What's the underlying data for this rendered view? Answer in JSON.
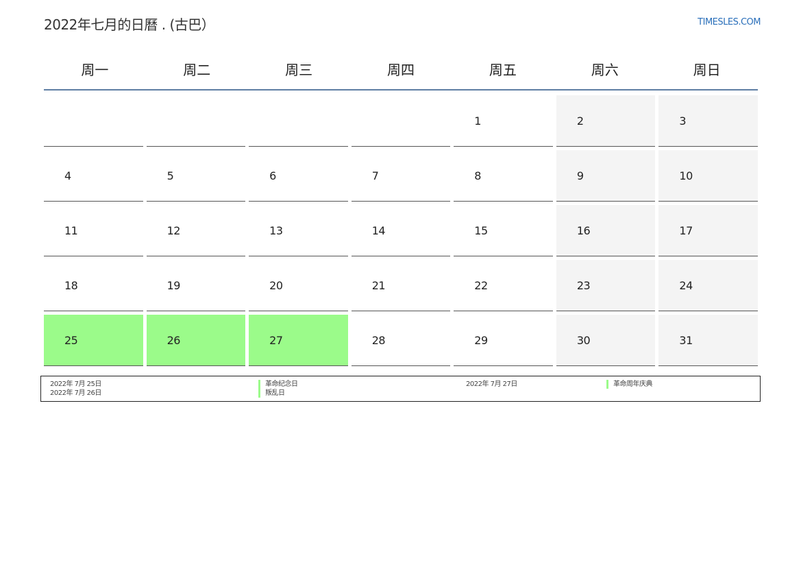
{
  "header": {
    "title": "2022年七月的日曆 . (古巴）",
    "brand": "TIMESLES.COM"
  },
  "weekdays": [
    "周一",
    "周二",
    "周三",
    "周四",
    "周五",
    "周六",
    "周日"
  ],
  "calendar": {
    "weeks": [
      [
        "",
        "",
        "",
        "",
        "1",
        "2",
        "3"
      ],
      [
        "4",
        "5",
        "6",
        "7",
        "8",
        "9",
        "10"
      ],
      [
        "11",
        "12",
        "13",
        "14",
        "15",
        "16",
        "17"
      ],
      [
        "18",
        "19",
        "20",
        "21",
        "22",
        "23",
        "24"
      ],
      [
        "25",
        "26",
        "27",
        "28",
        "29",
        "30",
        "31"
      ]
    ],
    "holidays": [
      "25",
      "26",
      "27"
    ],
    "holiday_color": "#9bfb8a",
    "weekend_color": "#f4f4f4"
  },
  "legend": {
    "entries": [
      {
        "date": "2022年 7月 25日",
        "name": "革命纪念日"
      },
      {
        "date": "2022年 7月 26日",
        "name": "叛乱日"
      },
      {
        "date": "2022年 7月 27日",
        "name": "革命周年庆典"
      }
    ]
  }
}
